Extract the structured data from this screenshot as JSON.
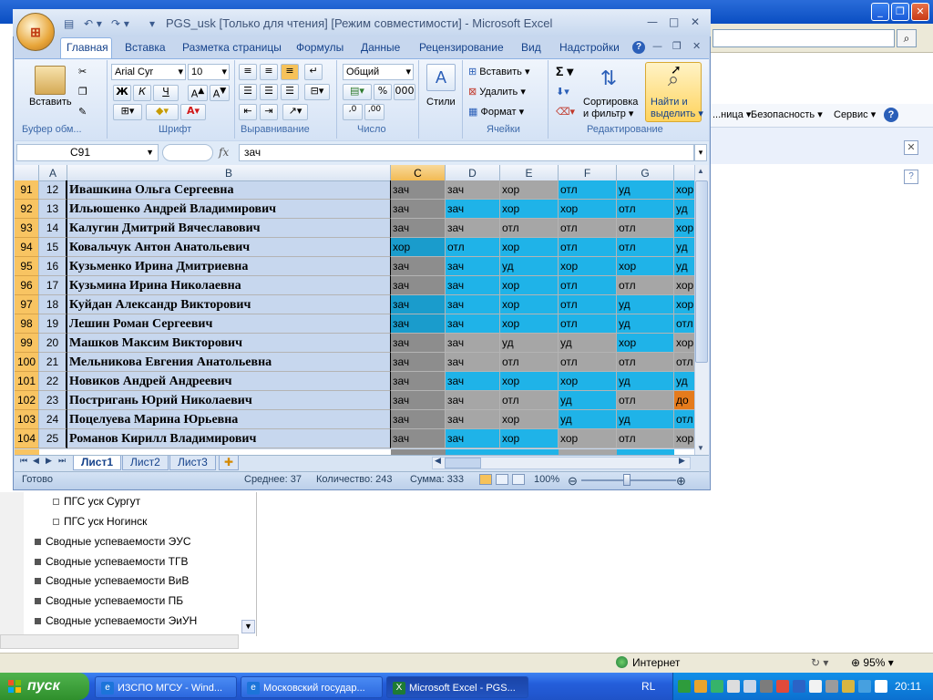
{
  "excel": {
    "title": "PGS_usk  [Только для чтения]  [Режим совместимости] - Microsoft Excel",
    "tabs": [
      "Главная",
      "Вставка",
      "Разметка страницы",
      "Формулы",
      "Данные",
      "Рецензирование",
      "Вид",
      "Надстройки"
    ],
    "ribbon": {
      "paste_label": "Вставить",
      "clipboard_group": "Буфер обм...",
      "font_name": "Arial Cyr",
      "font_size": "10",
      "font_group": "Шрифт",
      "bold": "Ж",
      "italic": "К",
      "underline": "Ч",
      "align_group": "Выравнивание",
      "number_format": "Общий",
      "number_group": "Число",
      "percent": "%",
      "thousands": "000",
      "styles_label": "Стили",
      "insert_label": "Вставить",
      "delete_label": "Удалить",
      "format_label": "Формат",
      "cells_group": "Ячейки",
      "sort_label_1": "Сортировка",
      "sort_label_2": "и фильтр",
      "find_label_1": "Найти и",
      "find_label_2": "выделить",
      "editing_group": "Редактирование",
      "sigma": "Σ"
    },
    "formula_bar": {
      "name_box": "C91",
      "fx": "fx",
      "content": "зач"
    },
    "columns": [
      "A",
      "B",
      "C",
      "D",
      "E",
      "F",
      "G"
    ],
    "rows": [
      {
        "rn": "91",
        "a": "12",
        "b": "Ивашкина Ольга Сергеевна",
        "c": "зач",
        "d": "зач",
        "e": "хор",
        "f": "отл",
        "g": "уд",
        "h": "хор"
      },
      {
        "rn": "92",
        "a": "13",
        "b": "Ильюшенко Андрей Владимирович",
        "c": "зач",
        "d": "зач",
        "e": "хор",
        "f": "хор",
        "g": "отл",
        "h": "уд"
      },
      {
        "rn": "93",
        "a": "14",
        "b": "Калугин Дмитрий Вячеславович",
        "c": "зач",
        "d": "зач",
        "e": "отл",
        "f": "отл",
        "g": "отл",
        "h": "хор"
      },
      {
        "rn": "94",
        "a": "15",
        "b": "Ковальчук Антон Анатольевич",
        "c": "хор",
        "d": "отл",
        "e": "хор",
        "f": "отл",
        "g": "отл",
        "h": "уд"
      },
      {
        "rn": "95",
        "a": "16",
        "b": "Кузьменко Ирина Дмитриевна",
        "c": "зач",
        "d": "зач",
        "e": "уд",
        "f": "хор",
        "g": "хор",
        "h": "уд"
      },
      {
        "rn": "96",
        "a": "17",
        "b": "Кузьмина Ирина Николаевна",
        "c": "зач",
        "d": "зач",
        "e": "хор",
        "f": "отл",
        "g": "отл",
        "h": "хор"
      },
      {
        "rn": "97",
        "a": "18",
        "b": "Куйдан  Александр Викторович",
        "c": "зач",
        "d": "зач",
        "e": "хор",
        "f": "отл",
        "g": "уд",
        "h": "хор"
      },
      {
        "rn": "98",
        "a": "19",
        "b": "Лешин Роман Сергеевич",
        "c": "зач",
        "d": "зач",
        "e": "хор",
        "f": "отл",
        "g": "уд",
        "h": "отл"
      },
      {
        "rn": "99",
        "a": "20",
        "b": "Машков Максим Викторович",
        "c": "зач",
        "d": "зач",
        "e": "уд",
        "f": "уд",
        "g": "хор",
        "h": "хор"
      },
      {
        "rn": "100",
        "a": "21",
        "b": "Мельникова Евгения Анатольевна",
        "c": "зач",
        "d": "зач",
        "e": "отл",
        "f": "отл",
        "g": "отл",
        "h": "отл"
      },
      {
        "rn": "101",
        "a": "22",
        "b": "Новиков Андрей Андреевич",
        "c": "зач",
        "d": "зач",
        "e": "хор",
        "f": "хор",
        "g": "уд",
        "h": "уд"
      },
      {
        "rn": "102",
        "a": "23",
        "b": "Постригань Юрий Николаевич",
        "c": "зач",
        "d": "зач",
        "e": "отл",
        "f": "уд",
        "g": "отл",
        "h": "до"
      },
      {
        "rn": "103",
        "a": "24",
        "b": "Поцелуева Марина Юрьевна",
        "c": "зач",
        "d": "зач",
        "e": "хор",
        "f": "уд",
        "g": "уд",
        "h": "отл"
      },
      {
        "rn": "104",
        "a": "25",
        "b": "Романов Кирилл Владимирович",
        "c": "зач",
        "d": "зач",
        "e": "хор",
        "f": "хор",
        "g": "отл",
        "h": "хор"
      }
    ],
    "sheets": [
      "Лист1",
      "Лист2",
      "Лист3"
    ],
    "status": {
      "ready": "Готово",
      "average": "Среднее: 37",
      "count": "Количество: 243",
      "sum": "Сумма: 333",
      "zoom": "100%"
    }
  },
  "browser": {
    "command_items": [
      "...ница ▾",
      "Безопасность ▾",
      "Сервис ▾"
    ],
    "tree": [
      {
        "label": "ПГС уск Сургут",
        "type": "leaf"
      },
      {
        "label": "ПГС уск Ногинск",
        "type": "leaf"
      },
      {
        "label": "Сводные успеваемости ЭУС",
        "type": "node"
      },
      {
        "label": "Сводные успеваемости ТГВ",
        "type": "node"
      },
      {
        "label": "Сводные успеваемости ВиВ",
        "type": "node"
      },
      {
        "label": "Сводные успеваемости ПБ",
        "type": "node"
      },
      {
        "label": "Сводные успеваемости ЭиУН",
        "type": "node"
      }
    ],
    "status_zone": "Интернет",
    "zoom": "95%"
  },
  "taskbar": {
    "start": "пуск",
    "tasks": [
      "ИЗСПО МГСУ - Wind...",
      "Московский государ...",
      "Microsoft Excel - PGS..."
    ],
    "lang": "RL",
    "clock": "20:11"
  },
  "colors": {
    "blue_cell": "#1fb3e8",
    "gray_cell": "#a6a6a6",
    "orange_cell": "#e57b1c",
    "row_header": "#f8c462"
  }
}
